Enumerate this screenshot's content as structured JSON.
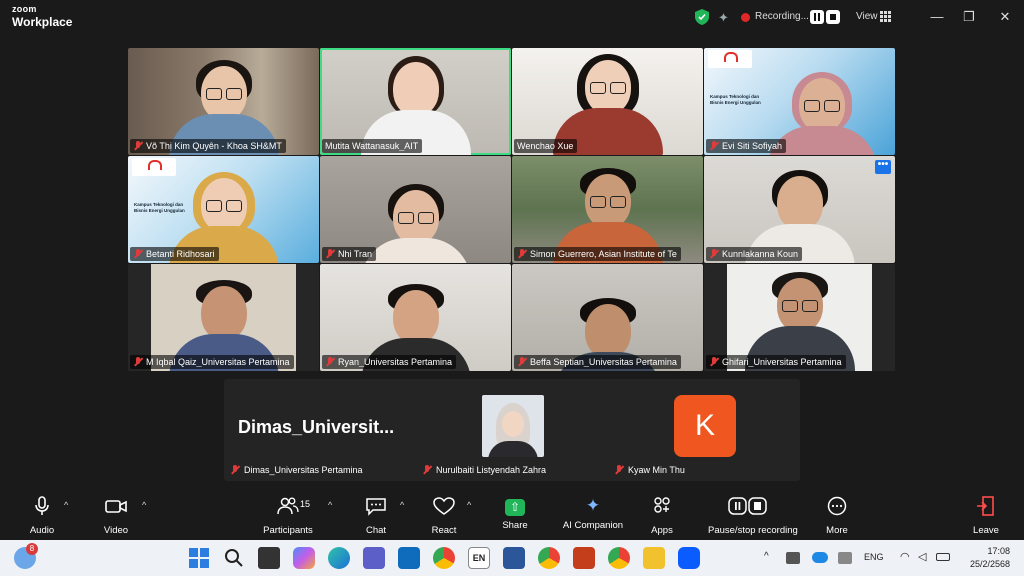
{
  "app": {
    "brand_top": "zoom",
    "brand_bottom": "Workplace"
  },
  "titlebar": {
    "recording_label": "Recording...",
    "view_label": "View"
  },
  "grid": {
    "tiles": [
      {
        "name": "Võ Thị Kim Quyên - Khoa SH&MT",
        "muted": true
      },
      {
        "name": "Mutita Wattanasuk_AIT",
        "muted": false,
        "active": true
      },
      {
        "name": "Wenchao Xue",
        "muted": false
      },
      {
        "name": "Evi Siti Sofiyah",
        "muted": true
      },
      {
        "name": "Betanti Ridhosari",
        "muted": true
      },
      {
        "name": "Nhi Tran",
        "muted": true
      },
      {
        "name": "Simon Guerrero, Asian Institute of Te",
        "muted": true
      },
      {
        "name": "Kunnlakanna Koun",
        "muted": true
      },
      {
        "name": "M Iqbal Qaiz_Universitas Pertamina",
        "muted": true
      },
      {
        "name": "Ryan_Universitas Pertamina",
        "muted": true
      },
      {
        "name": "Beffa Septian_Universitas Pertamina",
        "muted": true
      },
      {
        "name": "Ghifari_Universitas Pertamina",
        "muted": true
      }
    ],
    "banner_text": "Kampus Teknologi dan Bisnis Energi Unggulan",
    "more_badge": "•••"
  },
  "row2": {
    "big_name": "Dimas_Universit...",
    "tag1": "Dimas_Universitas Pertamina",
    "tag2": "Nurulbaiti Listyendah Zahra",
    "tag3": "Kyaw Min Thu",
    "k_letter": "K"
  },
  "toolbar": {
    "audio": "Audio",
    "video": "Video",
    "participants": "Participants",
    "participants_count": "15",
    "chat": "Chat",
    "react": "React",
    "share": "Share",
    "ai": "AI Companion",
    "apps": "Apps",
    "record": "Pause/stop recording",
    "more": "More",
    "leave": "Leave"
  },
  "taskbar": {
    "notif_count": "8",
    "lang": "ENG",
    "en_badge": "EN",
    "time": "17:08",
    "date": "25/2/2568"
  },
  "colors": {
    "accent_green": "#3ddc84",
    "share_green": "#21b55a",
    "record_red": "#e02828",
    "k_orange": "#f0561f"
  }
}
